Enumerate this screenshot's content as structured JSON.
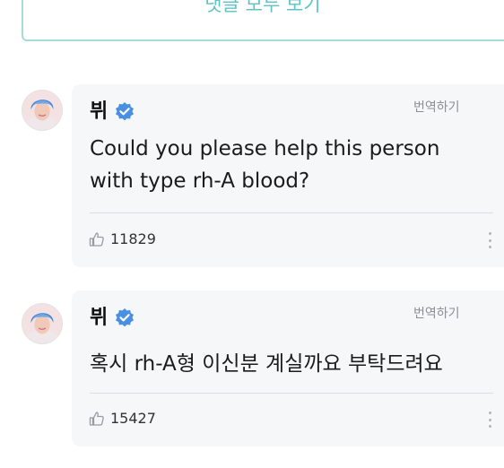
{
  "top_button": {
    "label": "댓글 모두 보기"
  },
  "comments": [
    {
      "author": "뷔",
      "verified": true,
      "translate_label": "번역하기",
      "text_lines": [
        "Could you please help this person",
        "with type rh-A blood?"
      ],
      "likes": "11829",
      "avatar_icon": "user-avatar-icon",
      "like_icon": "thumbs-up-icon",
      "menu_icon": "more-vertical-icon"
    },
    {
      "author": "뷔",
      "verified": true,
      "translate_label": "번역하기",
      "text_lines": [
        "혹시 rh-A형 이신분 계실까요 부탁드려요"
      ],
      "likes": "15427",
      "avatar_icon": "user-avatar-icon",
      "like_icon": "thumbs-up-icon",
      "menu_icon": "more-vertical-icon"
    }
  ],
  "colors": {
    "accent_teal": "#5fc4c1",
    "verified_blue": "#4a90e2",
    "card_background": "#f6f7f9"
  }
}
